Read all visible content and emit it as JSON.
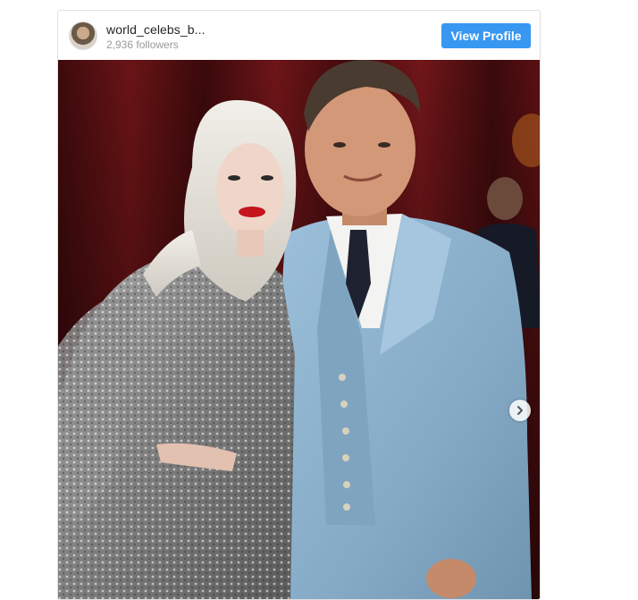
{
  "profile": {
    "username": "world_celebs_b...",
    "followers": "2,936 followers",
    "view_profile_label": "View Profile"
  },
  "carousel": {
    "next_icon": "chevron-right-icon"
  },
  "colors": {
    "button": "#3897f0",
    "curtain": "#5a0f12",
    "suit": "#8fb4cf"
  }
}
